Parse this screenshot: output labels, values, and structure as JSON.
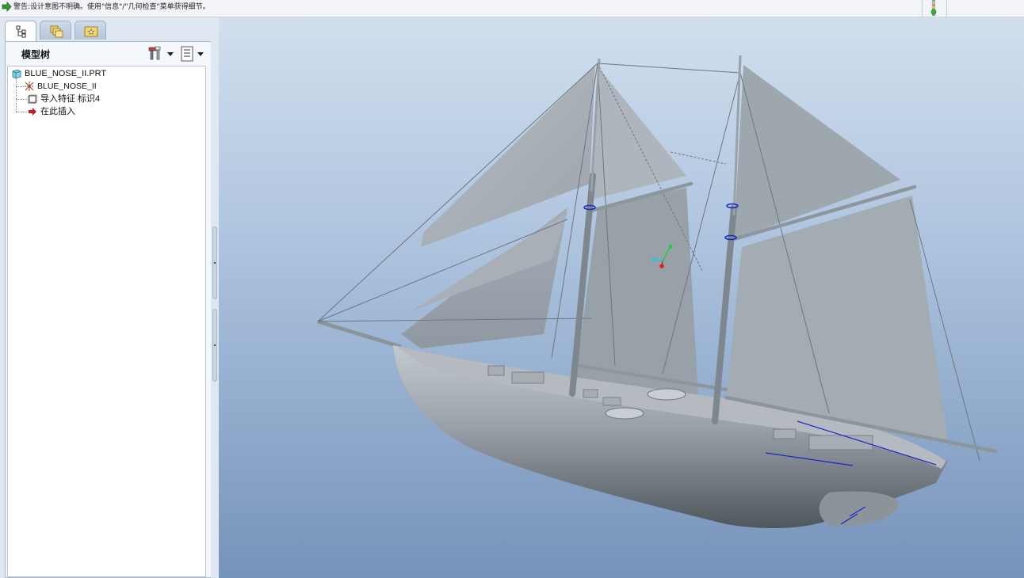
{
  "message_bar": {
    "message": "警告:设计意图不明确。使用\"信息\"/\"几何检查\"菜单获得细节。",
    "status_light": "traffic-light-icon"
  },
  "navigator": {
    "tabs": [
      {
        "name": "model-tree",
        "icon": "model-tree-icon",
        "active": true
      },
      {
        "name": "folder-browser",
        "icon": "folder-icon",
        "active": false
      },
      {
        "name": "favorites",
        "icon": "favorites-icon",
        "active": false
      }
    ],
    "title": "模型树",
    "settings_icon": "tools-icon",
    "show_icon": "list-icon"
  },
  "tree": {
    "root": "BLUE_NOSE_II.PRT",
    "items": [
      {
        "label": "BLUE_NOSE_II",
        "icon": "csys-icon"
      },
      {
        "label": "导入特征 标识4",
        "icon": "import-feature-icon"
      },
      {
        "label": "在此插入",
        "icon": "insert-here-arrow-icon"
      }
    ]
  },
  "viewport": {
    "model": "BLUE_NOSE_II schooner 3D model",
    "background_top": "#d2dfee",
    "background_bottom": "#7693ba"
  }
}
